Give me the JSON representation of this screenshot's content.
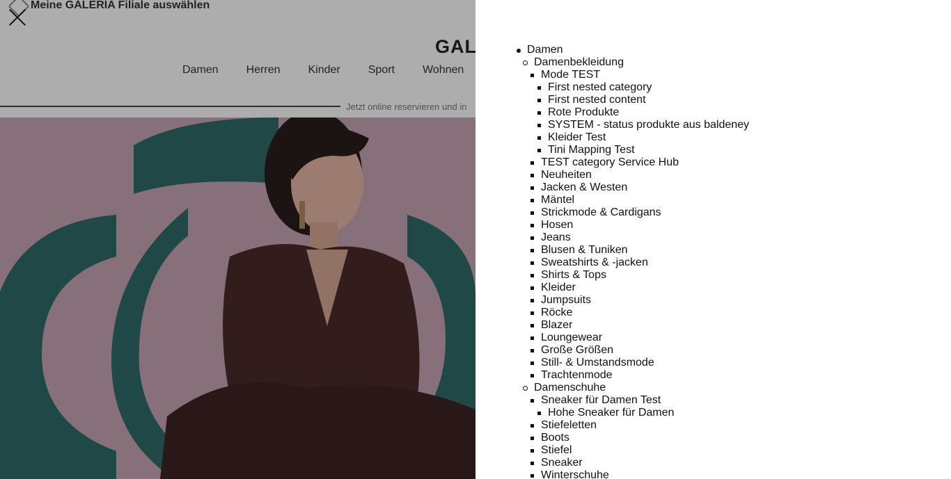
{
  "store_selector": {
    "label": "Meine GALERIA Filiale auswählen",
    "icon": "store-icon"
  },
  "logo": {
    "text": "GAL"
  },
  "main_nav": [
    "Damen",
    "Herren",
    "Kinder",
    "Sport",
    "Wohnen"
  ],
  "promo": {
    "text": "Jetzt online reservieren und in"
  },
  "close": {
    "icon": "close-icon"
  },
  "colors": {
    "overlay": "#000000",
    "hero_bg": "#c8a5b4",
    "hero_ring": "#2f6a68",
    "top_wear": "#4a2a2a"
  },
  "menu": {
    "damen": {
      "label": "Damen",
      "bekleidung": {
        "label": "Damenbekleidung",
        "mode_test": {
          "label": "Mode TEST",
          "children": [
            "First nested category",
            "First nested content",
            "Rote Produkte",
            "SYSTEM - status produkte aus baldeney",
            "Kleider Test",
            "Tini Mapping Test"
          ]
        },
        "items": [
          "TEST category Service Hub",
          "Neuheiten",
          "Jacken & Westen",
          "Mäntel",
          "Strickmode & Cardigans",
          "Hosen",
          "Jeans",
          "Blusen & Tuniken",
          "Sweatshirts & -jacken",
          "Shirts & Tops",
          "Kleider",
          "Jumpsuits",
          "Röcke",
          "Blazer",
          "Loungewear",
          "Große Größen",
          "Still- & Umstandsmode",
          "Trachtenmode"
        ]
      },
      "schuhe": {
        "label": "Damenschuhe",
        "sneaker": {
          "label": "Sneaker für Damen Test",
          "children": [
            "Hohe Sneaker für Damen"
          ]
        },
        "items": [
          "Stiefeletten",
          "Boots",
          "Stiefel",
          "Sneaker",
          "Winterschuhe"
        ]
      }
    }
  }
}
